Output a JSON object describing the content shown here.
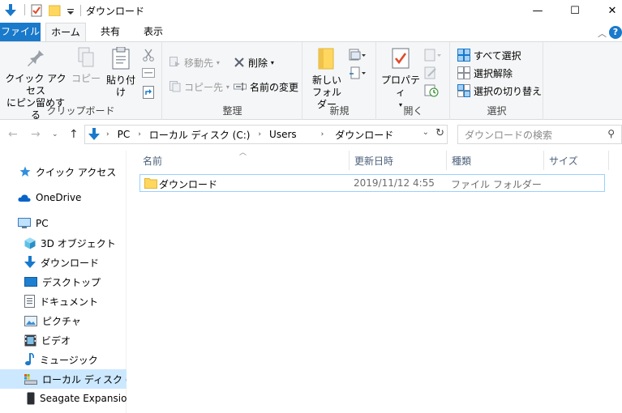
{
  "window": {
    "title": "ダウンロード",
    "minimize_glyph": "—",
    "maximize_glyph": "☐",
    "close_glyph": "✕"
  },
  "ribbon_tabs": {
    "file": "ファイル",
    "home": "ホーム",
    "share": "共有",
    "view": "表示",
    "help": "?"
  },
  "ribbon": {
    "clipboard": {
      "label": "クリップボード",
      "pin_line1": "クイック アクセス",
      "pin_line2": "にピン留めする",
      "copy": "コピー",
      "paste": "貼り付け"
    },
    "organize": {
      "label": "整理",
      "move_to": "移動先",
      "copy_to": "コピー先",
      "delete": "削除",
      "rename": "名前の変更"
    },
    "new": {
      "label": "新規",
      "new_folder_line1": "新しい",
      "new_folder_line2": "フォルダー"
    },
    "open": {
      "label": "開く",
      "properties": "プロパティ"
    },
    "select": {
      "label": "選択",
      "select_all": "すべて選択",
      "select_none": "選択解除",
      "invert": "選択の切り替え"
    }
  },
  "address": {
    "crumbs": [
      "PC",
      "ローカル ディスク (C:)",
      "Users",
      "ダウンロード"
    ],
    "search_placeholder": "ダウンロードの検索"
  },
  "sidebar": {
    "items": [
      {
        "label": "クイック アクセス",
        "icon": "star-icon"
      },
      {
        "label": "OneDrive",
        "icon": "cloud-icon"
      },
      {
        "label": "PC",
        "icon": "computer-icon"
      },
      {
        "label": "3D オブジェクト",
        "icon": "cube-icon"
      },
      {
        "label": "ダウンロード",
        "icon": "download-arrow-icon"
      },
      {
        "label": "デスクトップ",
        "icon": "desktop-icon"
      },
      {
        "label": "ドキュメント",
        "icon": "document-icon"
      },
      {
        "label": "ピクチャ",
        "icon": "picture-icon"
      },
      {
        "label": "ビデオ",
        "icon": "video-icon"
      },
      {
        "label": "ミュージック",
        "icon": "music-note-icon"
      },
      {
        "label": "ローカル ディスク (C:)",
        "icon": "drive-icon"
      },
      {
        "label": "Seagate Expansion Drive (D:)",
        "icon": "external-drive-icon"
      }
    ]
  },
  "columns": {
    "name": "名前",
    "modified": "更新日時",
    "type": "種類",
    "size": "サイズ"
  },
  "files": [
    {
      "name": "ダウンロード",
      "modified": "2019/11/12 4:55",
      "type": "ファイル フォルダー",
      "size": ""
    }
  ],
  "colors": {
    "accent": "#1979ca",
    "selection": "#cce8ff",
    "row_border": "#99d1ff",
    "folder": "#ffd75e"
  }
}
